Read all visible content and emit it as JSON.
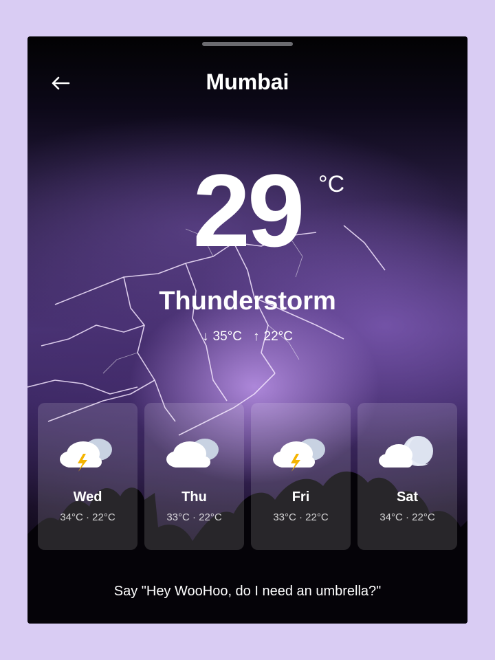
{
  "header": {
    "city": "Mumbai",
    "back_icon": "arrow-left-icon"
  },
  "current": {
    "temperature": "29",
    "unit": "°C",
    "condition": "Thunderstorm",
    "low": "35°C",
    "high": "22°C"
  },
  "forecast": [
    {
      "day": "Wed",
      "temps": "34°C · 22°C",
      "icon": "thunderstorm-cloud-icon"
    },
    {
      "day": "Thu",
      "temps": "33°C · 22°C",
      "icon": "cloudy-icon"
    },
    {
      "day": "Fri",
      "temps": "33°C · 22°C",
      "icon": "thunderstorm-cloud-icon"
    },
    {
      "day": "Sat",
      "temps": "34°C · 22°C",
      "icon": "cloudy-night-icon"
    }
  ],
  "voice_prompt": "Say \"Hey WooHoo, do I need an umbrella?\"",
  "colors": {
    "page_background": "#d9ccf3",
    "accent_bolt": "#f5b400"
  }
}
